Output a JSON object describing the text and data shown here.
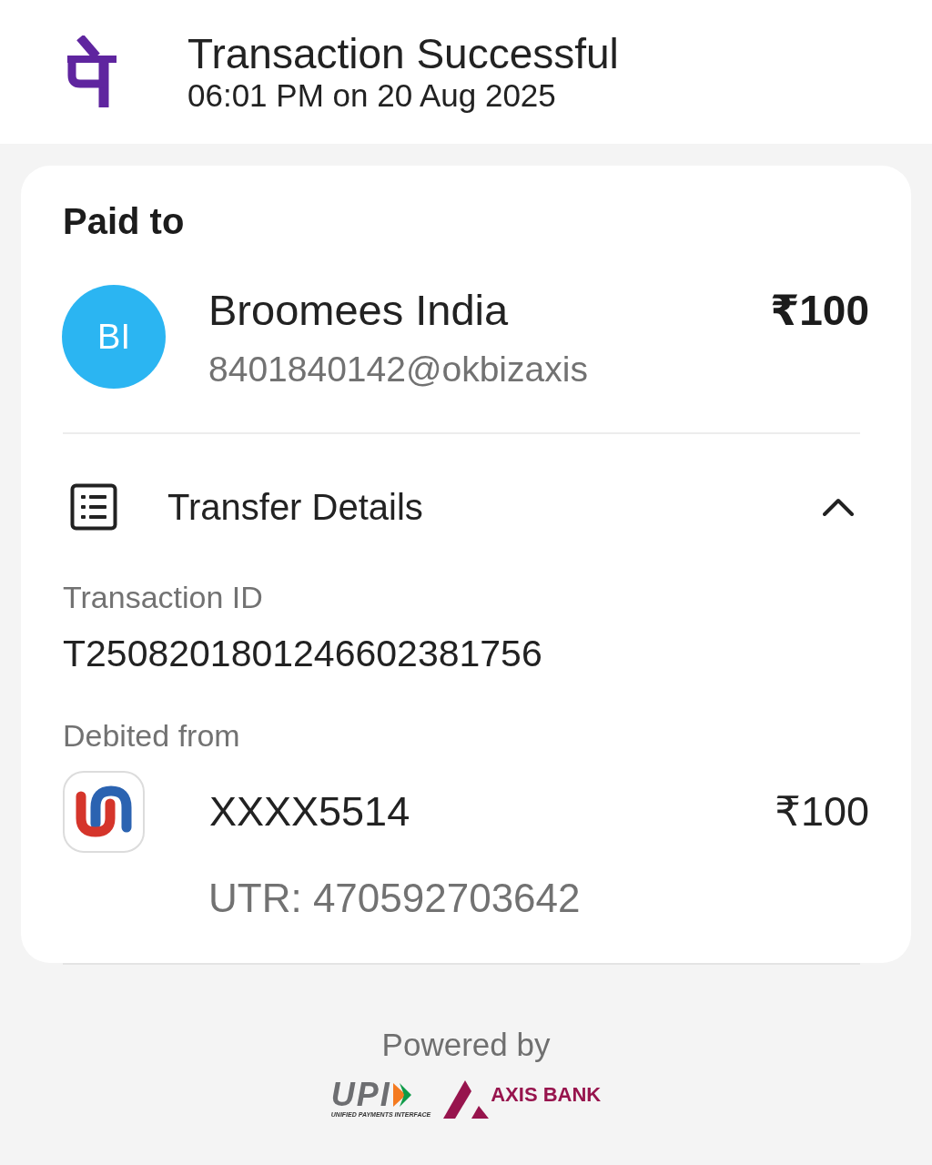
{
  "header": {
    "title": "Transaction Successful",
    "subtitle": "06:01 PM on 20 Aug 2025"
  },
  "paid_to": {
    "heading": "Paid to",
    "avatar_initials": "BI",
    "name": "Broomees India",
    "upi_id": "8401840142@okbizaxis",
    "amount": "₹100"
  },
  "transfer_details": {
    "title": "Transfer Details",
    "expanded": true,
    "fields": [
      {
        "label": "Transaction ID",
        "value": "T2508201801246602381756"
      }
    ],
    "debited_from": {
      "label": "Debited from",
      "account": "XXXX5514",
      "amount": "₹100",
      "utr": "UTR: 470592703642"
    }
  },
  "footer": {
    "powered_by": "Powered by",
    "logos": [
      {
        "kind": "upi",
        "text": "UPI",
        "tagline": "UNIFIED PAYMENTS INTERFACE"
      },
      {
        "kind": "bank",
        "text": "AXIS BANK"
      }
    ]
  }
}
